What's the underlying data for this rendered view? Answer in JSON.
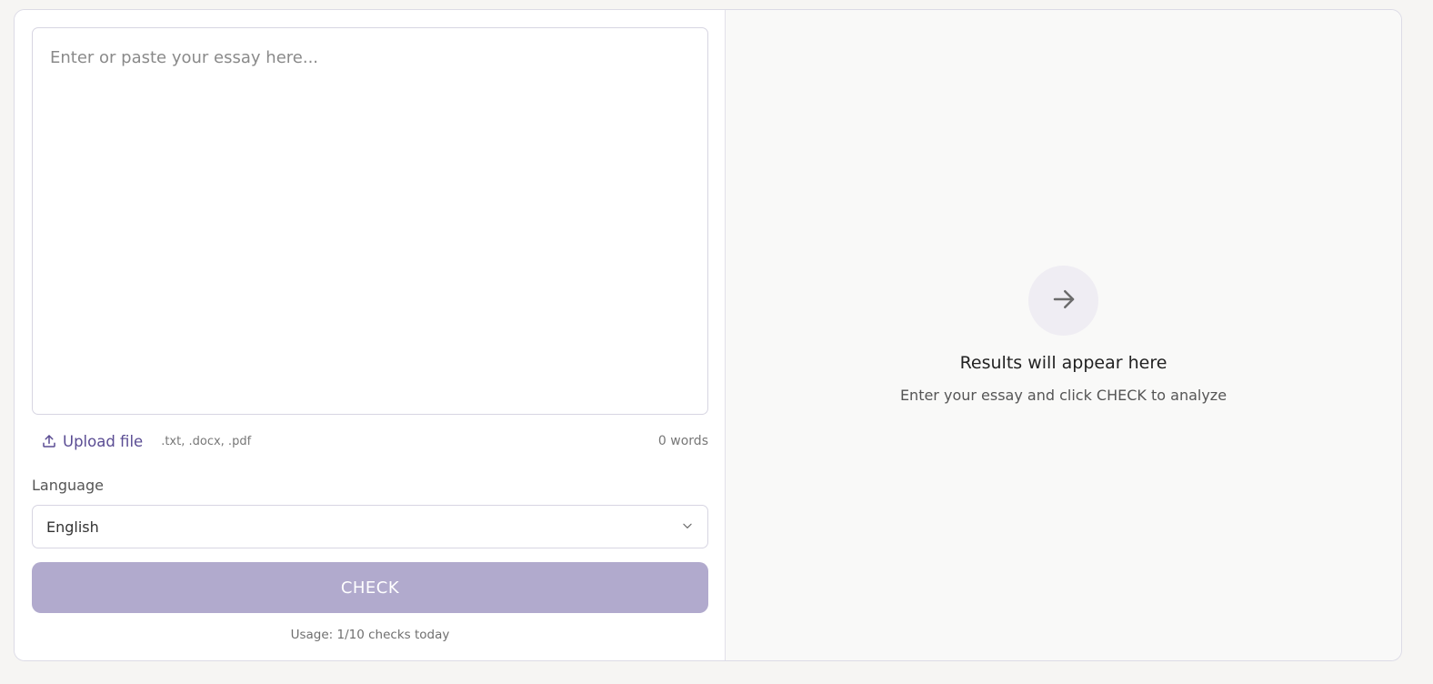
{
  "editor": {
    "placeholder": "Enter or paste your essay here...",
    "upload_label": "Upload file",
    "formats": ".txt, .docx, .pdf",
    "word_count": "0 words"
  },
  "language": {
    "label": "Language",
    "selected": "English"
  },
  "actions": {
    "check_label": "CHECK",
    "usage": "Usage: 1/10 checks today"
  },
  "results": {
    "icon": "arrow-right-icon",
    "title": "Results will appear here",
    "subtitle": "Enter your essay and click CHECK to analyze"
  },
  "colors": {
    "accent": "#5a4c93",
    "check_button": "#b1aacd",
    "results_bg": "#f9f9f8",
    "icon_circle": "#efedf3"
  }
}
